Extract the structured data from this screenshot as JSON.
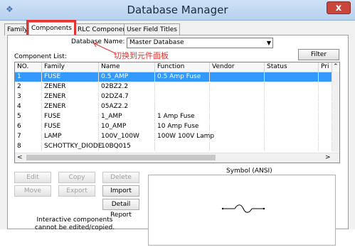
{
  "window": {
    "title": "Database Manager",
    "close_glyph": "x",
    "icon": "app-icon"
  },
  "tabs": [
    {
      "label": "Family",
      "active": false
    },
    {
      "label": "Components",
      "active": true
    },
    {
      "label": "RLC Components",
      "active": false
    },
    {
      "label": "User Field Titles",
      "active": false
    }
  ],
  "database": {
    "label": "Database Name:",
    "value": "Master Database"
  },
  "annotation": "切换到元件面板",
  "filter_label": "Filter",
  "component_list_label": "Component List:",
  "table": {
    "columns": [
      "NO.",
      "Family",
      "Name",
      "Function",
      "Vendor",
      "Status",
      "Pri"
    ],
    "rows": [
      {
        "no": "1",
        "family": "FUSE",
        "name": "0.5_AMP",
        "function": "0.5 Amp Fuse",
        "vendor": "",
        "status": "",
        "pri": ""
      },
      {
        "no": "2",
        "family": "ZENER",
        "name": "02BZ2.2",
        "function": "",
        "vendor": "",
        "status": "",
        "pri": ""
      },
      {
        "no": "3",
        "family": "ZENER",
        "name": "02DZ4.7",
        "function": "",
        "vendor": "",
        "status": "",
        "pri": ""
      },
      {
        "no": "4",
        "family": "ZENER",
        "name": "05AZ2.2",
        "function": "",
        "vendor": "",
        "status": "",
        "pri": ""
      },
      {
        "no": "5",
        "family": "FUSE",
        "name": "1_AMP",
        "function": "1 Amp Fuse",
        "vendor": "",
        "status": "",
        "pri": ""
      },
      {
        "no": "6",
        "family": "FUSE",
        "name": "10_AMP",
        "function": "10 Amp Fuse",
        "vendor": "",
        "status": "",
        "pri": ""
      },
      {
        "no": "7",
        "family": "LAMP",
        "name": "100V_100W",
        "function": "100W 100V Lamp",
        "vendor": "",
        "status": "",
        "pri": ""
      },
      {
        "no": "8",
        "family": "SCHOTTKY_DIODE",
        "name": "10BQ015",
        "function": "",
        "vendor": "",
        "status": "",
        "pri": ""
      }
    ],
    "selected_row": 0
  },
  "buttons": {
    "edit": "Edit",
    "copy": "Copy",
    "delete": "Delete",
    "move": "Move",
    "export": "Export",
    "import": "Import",
    "detail_report": "Detail Report"
  },
  "symbol_label": "Symbol (ANSI)",
  "info_text": "Interactive components cannot be edited/copied.",
  "colors": {
    "highlight": "#e53330",
    "selection": "#3399ff",
    "close": "#c9463d"
  }
}
